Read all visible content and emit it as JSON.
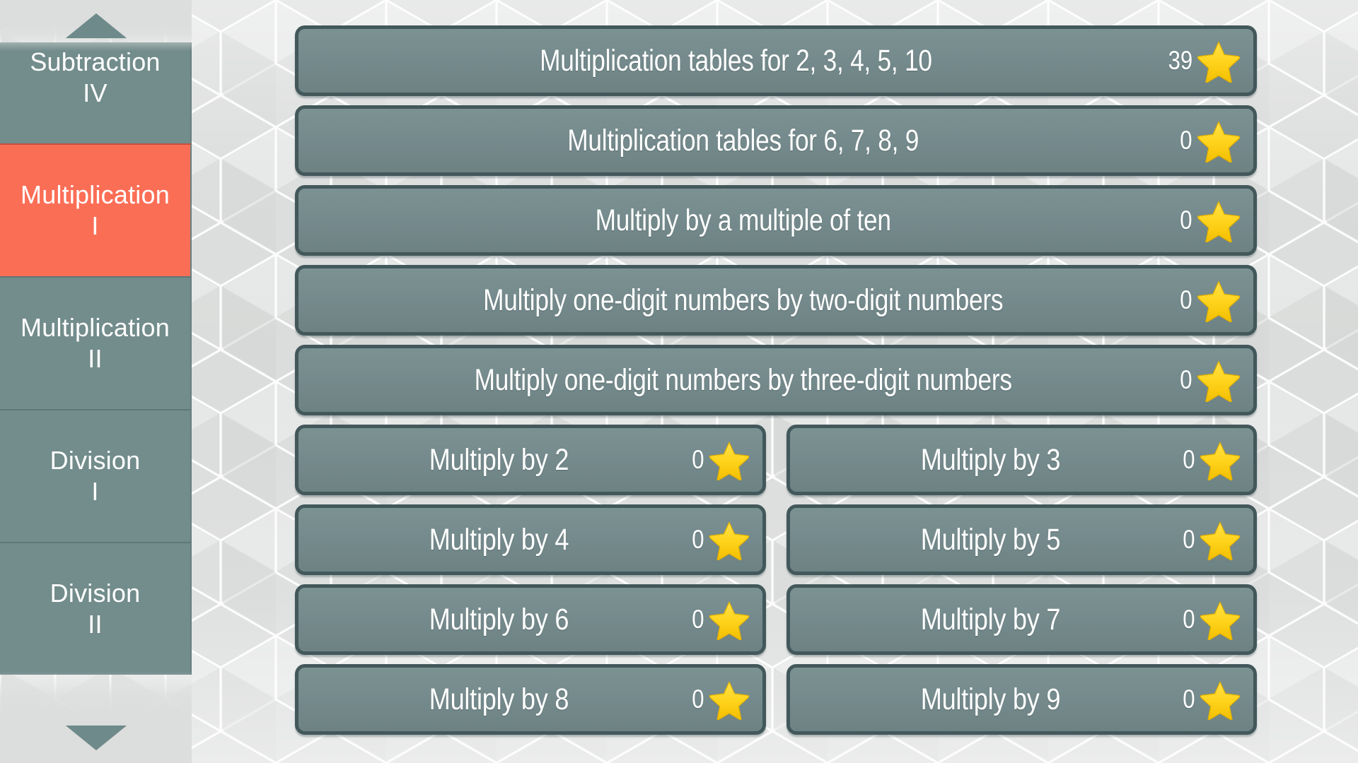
{
  "sidebar": {
    "scroll_up_icon": "triangle-up-icon",
    "scroll_down_icon": "triangle-down-icon",
    "items": [
      {
        "title": "Subtraction",
        "level": "IV",
        "selected": false
      },
      {
        "title": "Multiplication",
        "level": "I",
        "selected": true
      },
      {
        "title": "Multiplication",
        "level": "II",
        "selected": false
      },
      {
        "title": "Division",
        "level": "I",
        "selected": false
      },
      {
        "title": "Division",
        "level": "II",
        "selected": false
      }
    ],
    "selected_color": "#fb6e56",
    "item_color": "#738c8c"
  },
  "main": {
    "star_icon": "star-icon",
    "full_rows": [
      {
        "label": "Multiplication tables for 2, 3, 4, 5, 10",
        "score": "39"
      },
      {
        "label": "Multiplication tables for 6, 7, 8, 9",
        "score": "0"
      },
      {
        "label": "Multiply by a multiple of ten",
        "score": "0"
      },
      {
        "label": "Multiply one-digit numbers by two-digit numbers",
        "score": "0"
      },
      {
        "label": "Multiply one-digit numbers by three-digit numbers",
        "score": "0"
      }
    ],
    "split_rows": [
      {
        "left": {
          "label": "Multiply by 2",
          "score": "0"
        },
        "right": {
          "label": "Multiply by 3",
          "score": "0"
        }
      },
      {
        "left": {
          "label": "Multiply by 4",
          "score": "0"
        },
        "right": {
          "label": "Multiply by 5",
          "score": "0"
        }
      },
      {
        "left": {
          "label": "Multiply by 6",
          "score": "0"
        },
        "right": {
          "label": "Multiply by 7",
          "score": "0"
        }
      },
      {
        "left": {
          "label": "Multiply by 8",
          "score": "0"
        },
        "right": {
          "label": "Multiply by 9",
          "score": "0"
        }
      }
    ],
    "button_color": "#74898b",
    "button_border_color": "#43585b",
    "star_color": "#ffd51e"
  }
}
